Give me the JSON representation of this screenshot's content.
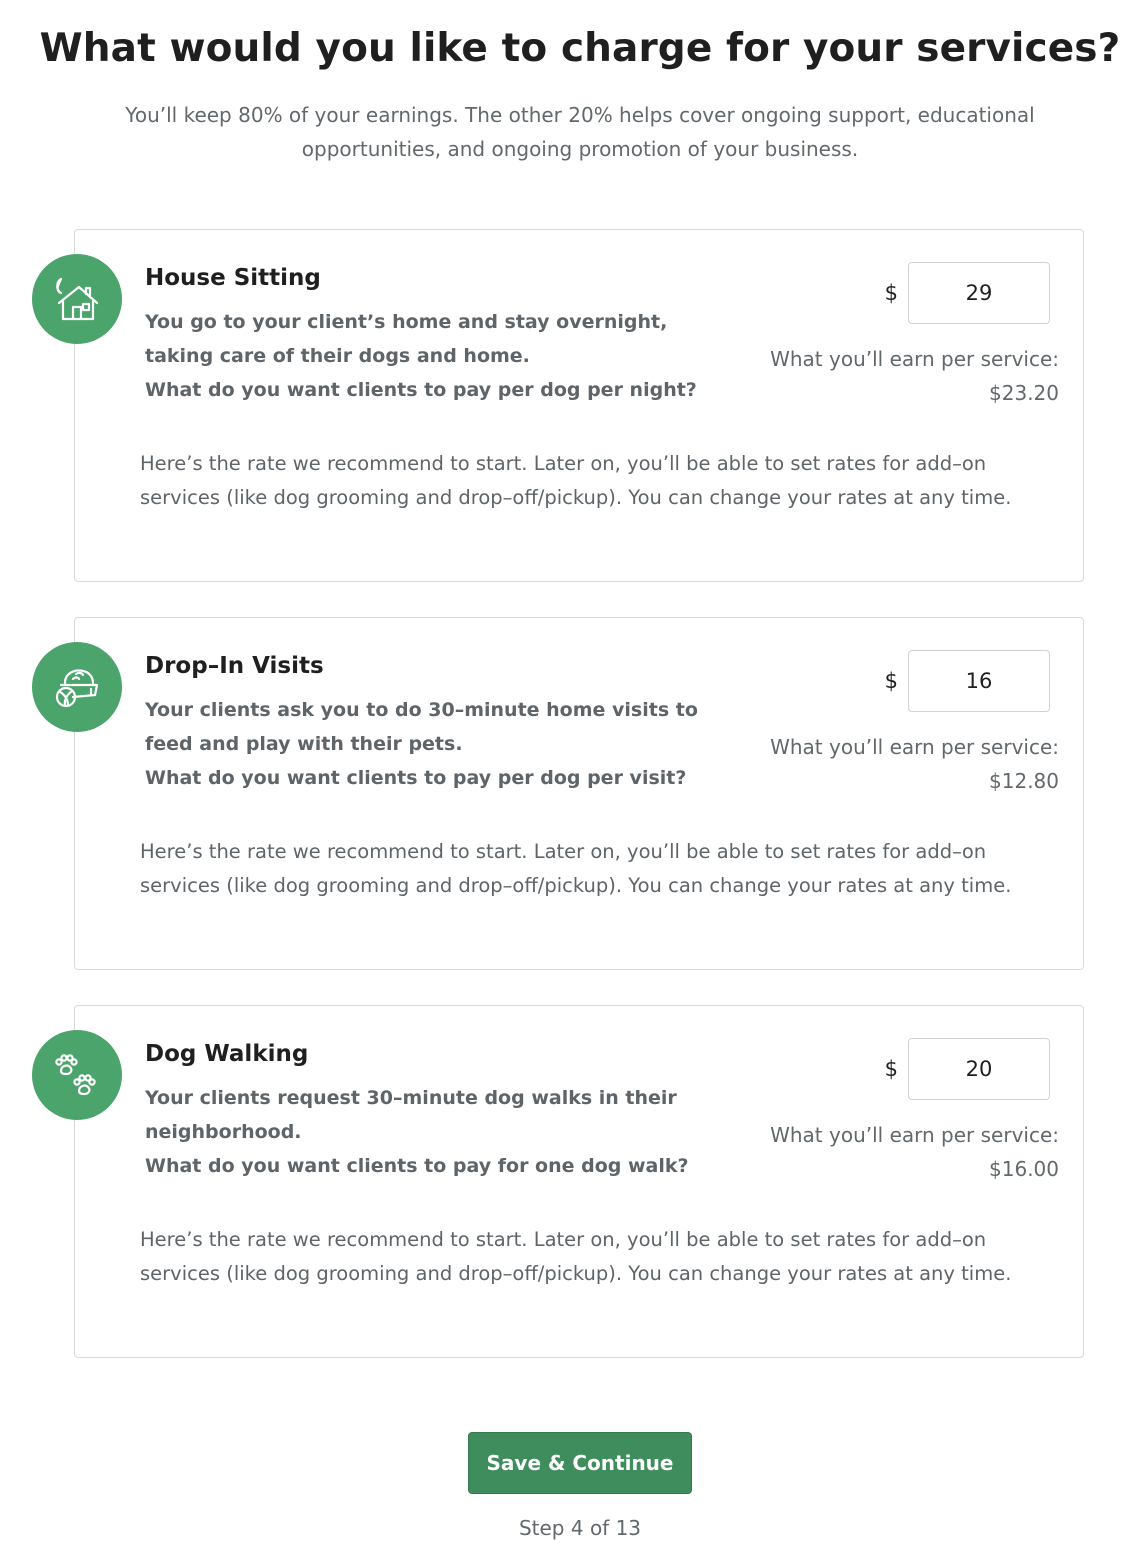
{
  "header": {
    "title": "What would you like to charge for your services?",
    "subtitle": "You’ll keep 80% of your earnings. The other 20% helps cover ongoing support, educational opportunities, and ongoing promotion of your business."
  },
  "services": [
    {
      "icon": "house-moon-icon",
      "title": "House Sitting",
      "description": "You go to your client’s home and stay overnight, taking care of their dogs and home.",
      "question": "What do you want clients to pay per dog per night?",
      "currency": "$",
      "rate": "29",
      "earn_label": "What you’ll earn per service:",
      "earn_amount": "$23.20",
      "recommendation": "Here’s the rate we recommend to start. Later on, you’ll be able to set rates for add–on services (like dog grooming and drop–off/pickup). You can change your rates at any time."
    },
    {
      "icon": "food-bowl-icon",
      "title": "Drop–In Visits",
      "description": "Your clients ask you to do 30–minute home visits to feed and play with their pets.",
      "question": "What do you want clients to pay per dog per visit?",
      "currency": "$",
      "rate": "16",
      "earn_label": "What you’ll earn per service:",
      "earn_amount": "$12.80",
      "recommendation": "Here’s the rate we recommend to start. Later on, you’ll be able to set rates for add–on services (like dog grooming and drop–off/pickup). You can change your rates at any time."
    },
    {
      "icon": "paw-prints-icon",
      "title": "Dog Walking",
      "description": "Your clients request 30–minute dog walks in their neighborhood.",
      "question": "What do you want clients to pay for one dog walk?",
      "currency": "$",
      "rate": "20",
      "earn_label": "What you’ll earn per service:",
      "earn_amount": "$16.00",
      "recommendation": "Here’s the rate we recommend to start. Later on, you’ll be able to set rates for add–on services (like dog grooming and drop–off/pickup). You can change your rates at any time."
    }
  ],
  "footer": {
    "save_label": "Save & Continue",
    "step_label": "Step 4 of 13"
  },
  "colors": {
    "accent": "#4aa46c",
    "button": "#3f8d5c",
    "border": "#d7dadb",
    "muted_text": "#62686b"
  }
}
